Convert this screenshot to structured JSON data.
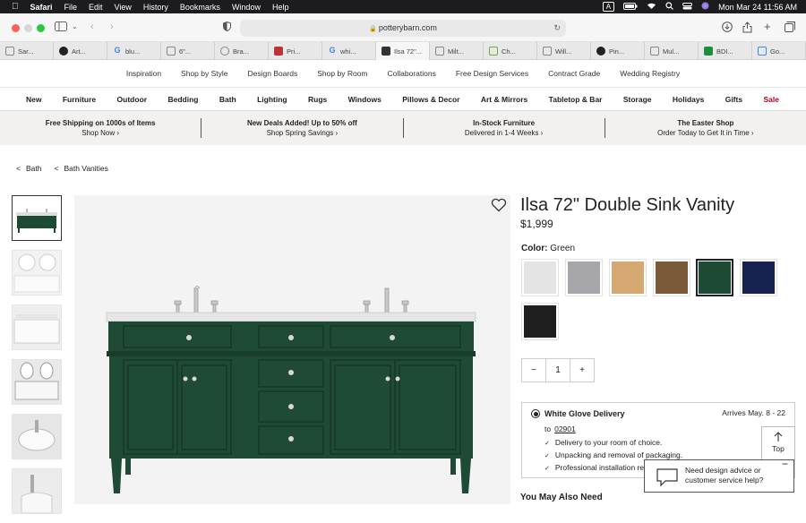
{
  "menubar": {
    "app": "Safari",
    "items": [
      "File",
      "Edit",
      "View",
      "History",
      "Bookmarks",
      "Window",
      "Help"
    ],
    "kbd": "A",
    "datetime": "Mon Mar 24  11:56 AM"
  },
  "browser": {
    "url": "potterybarn.com",
    "tabs": [
      "Sar...",
      "Art...",
      "blu...",
      "6\"...",
      "Bra...",
      "Pri...",
      "whi...",
      "Ilsa 72\"...",
      "Milt...",
      "Ch...",
      "Will...",
      "Pin...",
      "Mul...",
      "BDI...",
      "Go..."
    ]
  },
  "topnav": [
    "Inspiration",
    "Shop by Style",
    "Design Boards",
    "Shop by Room",
    "Collaborations",
    "Free Design Services",
    "Contract Grade",
    "Wedding Registry"
  ],
  "catnav": [
    "New",
    "Furniture",
    "Outdoor",
    "Bedding",
    "Bath",
    "Lighting",
    "Rugs",
    "Windows",
    "Pillows & Decor",
    "Art & Mirrors",
    "Tabletop & Bar",
    "Storage",
    "Holidays",
    "Gifts",
    "Sale"
  ],
  "promos": [
    {
      "title": "Free Shipping on 1000s of Items",
      "sub": "Shop Now ›"
    },
    {
      "title": "New Deals Added! Up to 50% off",
      "sub": "Shop Spring Savings ›"
    },
    {
      "title": "In-Stock Furniture",
      "sub": "Delivered in 1-4 Weeks ›"
    },
    {
      "title": "The Easter Shop",
      "sub": "Order Today to Get It in Time ›"
    }
  ],
  "breadcrumb": {
    "b1": "Bath",
    "b2": "Bath Vanities"
  },
  "product": {
    "title": "Ilsa 72\" Double Sink Vanity",
    "price": "$1,999",
    "color_label": "Color:",
    "color_value": "Green",
    "swatch_colors": [
      "#e4e4e4",
      "#a7a7ab",
      "#d6a871",
      "#7b5a3a",
      "#1d4a34",
      "#17214f",
      "#1e1e1e"
    ],
    "selected_swatch": 4,
    "quantity": "1",
    "qty_minus": "−",
    "qty_plus": "+"
  },
  "delivery": {
    "title": "White Glove Delivery",
    "arrives": "Arrives May. 8 - 22",
    "to_label": "to",
    "zip": "02901",
    "bullets": [
      "Delivery to your room of choice.",
      "Unpacking and removal of packaging.",
      "Professional installation re"
    ]
  },
  "top_button": "Top",
  "help": {
    "line1": "Need design advice or",
    "line2": "customer service help?"
  },
  "also_need": "You May Also Need"
}
